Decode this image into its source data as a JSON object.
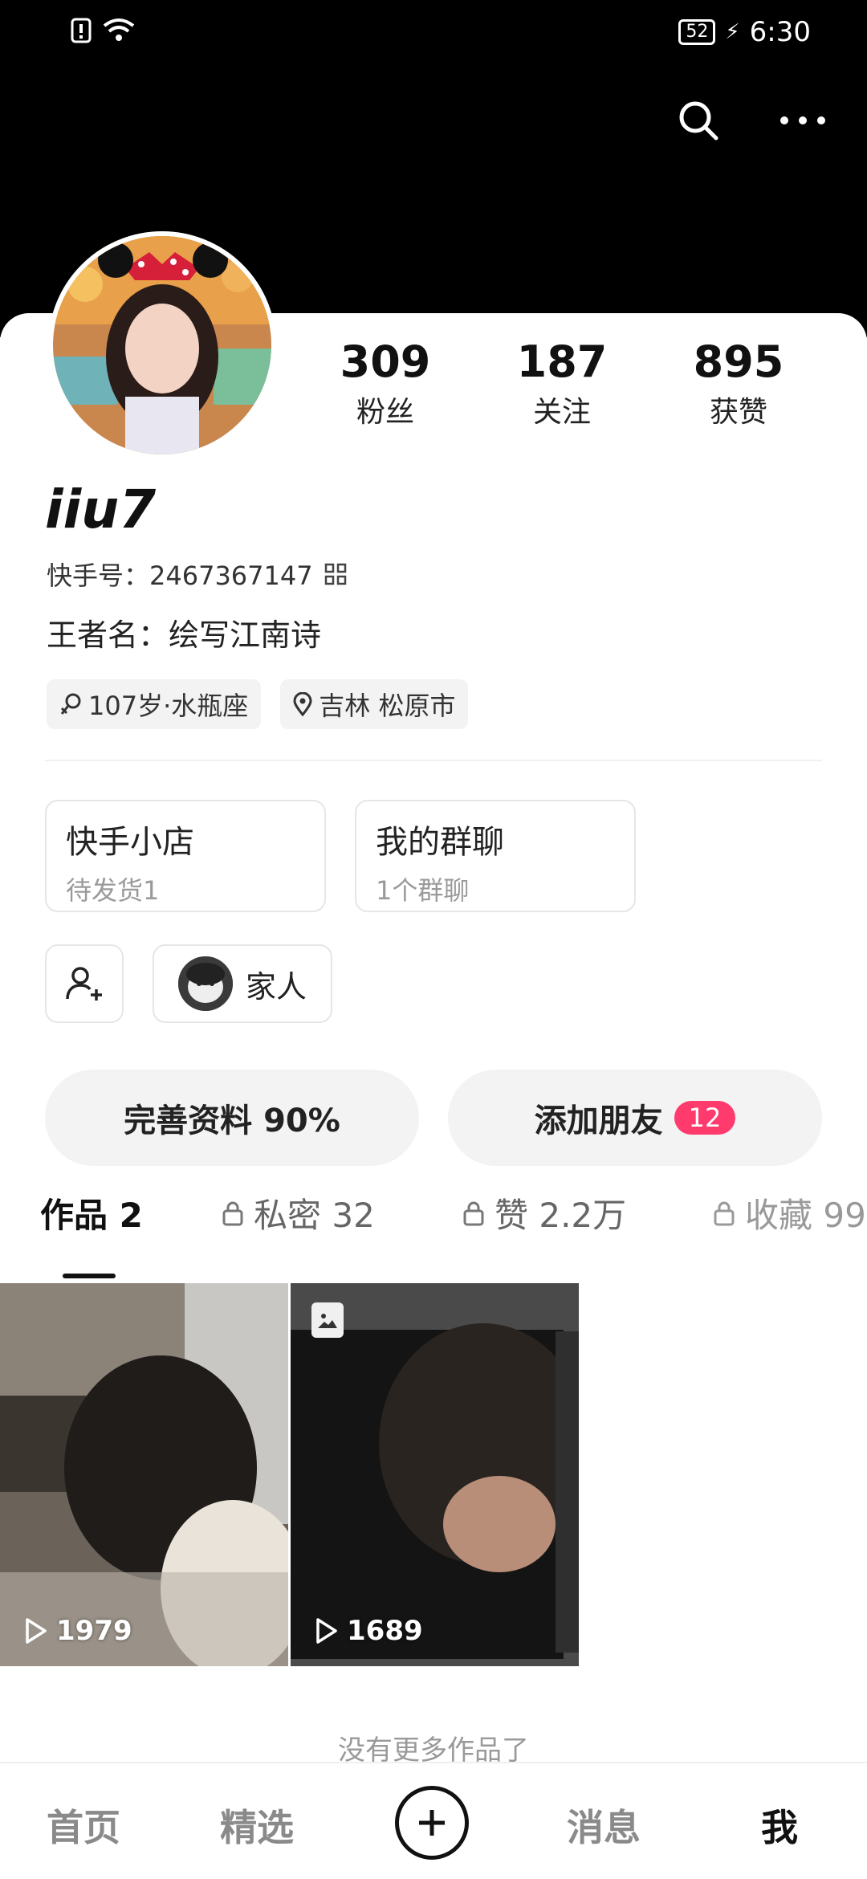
{
  "status_bar": {
    "battery": "52",
    "time": "6:30"
  },
  "profile": {
    "stats": [
      {
        "value": "309",
        "label": "粉丝"
      },
      {
        "value": "187",
        "label": "关注"
      },
      {
        "value": "895",
        "label": "获赞"
      }
    ],
    "name": "iiu7",
    "kuaishou_id": "快手号：2467367147",
    "wangzhe": "王者名：绘写江南诗",
    "tags": [
      {
        "icon": "gender-icon",
        "text": "107岁·水瓶座"
      },
      {
        "icon": "location-icon",
        "text": "吉林 松原市"
      }
    ]
  },
  "boxes": [
    {
      "title": "快手小店",
      "sub": "待发货1"
    },
    {
      "title": "我的群聊",
      "sub": "1个群聊"
    }
  ],
  "family": {
    "label": "家人"
  },
  "buttons": {
    "complete": "完善资料 90%",
    "add_friend": "添加朋友",
    "add_friend_badge": "12"
  },
  "tabs": [
    {
      "label": "作品 2",
      "locked": false,
      "active": true
    },
    {
      "label": "私密 32",
      "locked": true
    },
    {
      "label": "赞 2.2万",
      "locked": true
    },
    {
      "label": "收藏 99",
      "locked": true
    }
  ],
  "works": [
    {
      "plays": "1979"
    },
    {
      "plays": "1689"
    }
  ],
  "no_more": "没有更多作品了",
  "nav": {
    "home": "首页",
    "featured": "精选",
    "messages": "消息",
    "me": "我"
  },
  "colors": {
    "accent": "#ff3b6e",
    "header_bg": "#000000"
  }
}
